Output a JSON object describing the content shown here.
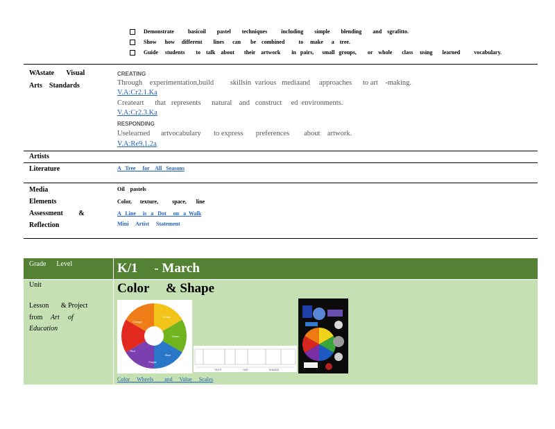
{
  "bullets": [
    "Demonstrate          basicoil        pastel        techniques          including        simple        blending        and    sgrafitto.",
    "Show      how     different        lines      can       be    combined          to     make      a    tree.",
    "Guide     students        to    talk    about       their    artwork        in   pairs,      small   groups,        or    whole       class     using       learned          vocabulary."
  ],
  "standards": {
    "label_line1": "WAstate       Visual",
    "label_line2": "Arts    Standards",
    "creating_heading": "CREATING",
    "creating_text": "Through    experimentation,build         skillsin  various   mediaand     approaches      to art    -making.",
    "creating_code1": "V.A:Cr2.1.Ka",
    "creating_text2": "Createart      that   represents      natural    and   construct     ed  environments.",
    "creating_code2": "V.A:Cr2.3.Ka",
    "responding_heading": "RESPONDING",
    "responding_text": "Uselearned      artvocabulary       to express       preferences        about    artwork.",
    "responding_code": "V.A:Re9.1.2a"
  },
  "artists": {
    "label": "Artists"
  },
  "literature": {
    "label": "Literature",
    "link": "A   Tree     for    All   Seasons"
  },
  "media": {
    "label_media": "Media",
    "label_elements": "Elements",
    "label_assessment": "Assessment         &",
    "label_reflection": "Reflection",
    "media_value": "Oil    pastels",
    "elements_value": "Color,      texture,          space,       line",
    "assessment_link": "A   Line     is   a   Dot     on   a  Walk",
    "reflection_value": "Mini     Artist     Statement"
  },
  "lesson": {
    "grade_label": "Grade      Level",
    "grade_value": "K/1     - March",
    "unit_label": "Unit",
    "unit_value": "Color     & Shape",
    "lp_line1": "Lesson       & Project",
    "lp_from": "from",
    "lp_art": "Art",
    "lp_of": "of",
    "lp_education": "Education",
    "caption_link": "Color     Wheels        and     Value     Scales",
    "wheel_labels": [
      "Yellow",
      "Green",
      "Blue",
      "Purple",
      "Red",
      "Orange"
    ],
    "scale_labels": [
      "TINTS",
      "HUE",
      "SHADES"
    ]
  },
  "colors": {
    "header_green": "#548235",
    "body_green": "#c5e0b3",
    "link_blue": "#1f5fbf"
  }
}
